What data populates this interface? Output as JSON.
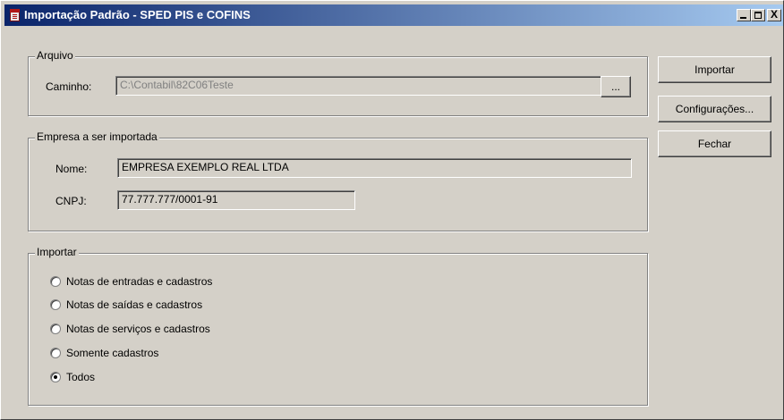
{
  "window": {
    "title": "Importação Padrão - SPED PIS e COFINS",
    "controls": {
      "minimize": "_",
      "maximize": "□",
      "close": "X"
    }
  },
  "arquivo": {
    "legend": "Arquivo",
    "caminho_label": "Caminho:",
    "caminho_value": "C:\\Contabil\\82C06Teste",
    "browse_label": "..."
  },
  "empresa": {
    "legend": "Empresa a ser importada",
    "nome_label": "Nome:",
    "nome_value": "EMPRESA EXEMPLO REAL LTDA",
    "cnpj_label": "CNPJ:",
    "cnpj_value": "77.777.777/0001-91"
  },
  "importar": {
    "legend": "Importar",
    "options": [
      {
        "label": "Notas de entradas e cadastros",
        "selected": false
      },
      {
        "label": "Notas de saídas e cadastros",
        "selected": false
      },
      {
        "label": "Notas de serviços e cadastros",
        "selected": false
      },
      {
        "label": "Somente cadastros",
        "selected": false
      },
      {
        "label": "Todos",
        "selected": true
      }
    ]
  },
  "buttons": {
    "importar": "Importar",
    "configuracoes": "Configurações...",
    "fechar": "Fechar"
  }
}
